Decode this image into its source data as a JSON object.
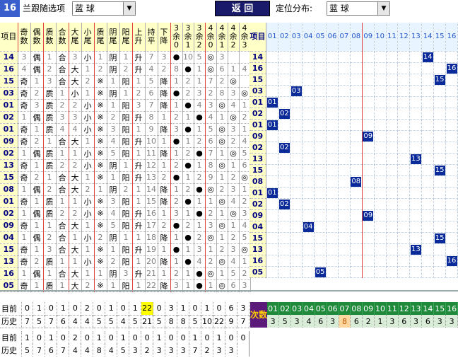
{
  "toolbar": {
    "issue_no": "16",
    "pick_label": "兰跟随选项",
    "pick_value": "蓝        球",
    "back_label": "返  回",
    "dist_label": "定位分布:",
    "dist_value": "蓝        球"
  },
  "left_headers": [
    "项目",
    "奇数",
    "偶数",
    "质数",
    "合数",
    "大尾",
    "小尾",
    "质尾",
    "阴尾",
    "阳尾",
    "上升",
    "持平",
    "下降",
    "3余0",
    "3余1",
    "3余2",
    "4余0",
    "4余1",
    "4余2",
    "4余3"
  ],
  "mid_header": "项目",
  "right_headers": [
    "01",
    "02",
    "03",
    "04",
    "05",
    "06",
    "07",
    "08",
    "09",
    "10",
    "11",
    "12",
    "13",
    "14",
    "15",
    "16"
  ],
  "rows": [
    {
      "id": "14",
      "c": [
        "3",
        "偶",
        "1",
        "合",
        "3",
        "小",
        "1",
        "阴",
        "1",
        "升",
        "7",
        "3",
        "●",
        "10",
        "5",
        "◎",
        "3"
      ],
      "ball": "14",
      "col": 13
    },
    {
      "id": "16",
      "c": [
        "4",
        "偶",
        "2",
        "合",
        "大",
        "1",
        "2",
        "阴",
        "2",
        "升",
        "4",
        "2",
        "8",
        "●",
        "1",
        "◎",
        "6",
        "1",
        "4"
      ],
      "ball": "16",
      "col": 15
    },
    {
      "id": "15",
      "c": [
        "奇",
        "1",
        "3",
        "合",
        "大",
        "2",
        "※",
        "1",
        "阳",
        "1",
        "5",
        "降",
        "1",
        "2",
        "1",
        "7",
        "2",
        "◎"
      ],
      "ball": "15",
      "col": 14
    },
    {
      "id": "03",
      "c": [
        "奇",
        "2",
        "质",
        "1",
        "小",
        "1",
        "※",
        "阴",
        "1",
        "2",
        "6",
        "降",
        "●",
        "2",
        "3",
        "2",
        "8",
        "3",
        "◎"
      ],
      "ball": "03",
      "col": 2
    },
    {
      "id": "01",
      "c": [
        "奇",
        "3",
        "质",
        "2",
        "2",
        "小",
        "※",
        "1",
        "阳",
        "3",
        "7",
        "降",
        "1",
        "●",
        "4",
        "3",
        "◎",
        "4",
        "1"
      ],
      "ball": "01",
      "col": 0
    },
    {
      "id": "02",
      "c": [
        "1",
        "偶",
        "质",
        "3",
        "3",
        "小",
        "※",
        "2",
        "阳",
        "升",
        "8",
        "1",
        "2",
        "1",
        "●",
        "4",
        "1",
        "◎",
        "2"
      ],
      "ball": "02",
      "col": 1
    },
    {
      "id": "01",
      "c": [
        "奇",
        "1",
        "质",
        "4",
        "4",
        "小",
        "※",
        "3",
        "阳",
        "1",
        "9",
        "降",
        "3",
        "●",
        "1",
        "5",
        "◎",
        "3",
        "1"
      ],
      "ball": "01",
      "col": 0
    },
    {
      "id": "09",
      "c": [
        "奇",
        "2",
        "1",
        "合",
        "大",
        "1",
        "※",
        "4",
        "阳",
        "升",
        "10",
        "1",
        "●",
        "1",
        "2",
        "6",
        "◎",
        "2",
        "4"
      ],
      "ball": "09",
      "col": 8
    },
    {
      "id": "02",
      "c": [
        "1",
        "偶",
        "质",
        "1",
        "1",
        "小",
        "※",
        "5",
        "阳",
        "1",
        "11",
        "降",
        "1",
        "2",
        "●",
        "7",
        "1",
        "◎",
        "5"
      ],
      "ball": "02",
      "col": 1
    },
    {
      "id": "13",
      "c": [
        "奇",
        "1",
        "质",
        "2",
        "2",
        "小",
        "※",
        "阴",
        "1",
        "升",
        "12",
        "1",
        "2",
        "●",
        "1",
        "8",
        "◎",
        "1",
        "6"
      ],
      "ball": "13",
      "col": 12
    },
    {
      "id": "15",
      "c": [
        "奇",
        "2",
        "1",
        "合",
        "大",
        "1",
        "※",
        "1",
        "阳",
        "升",
        "13",
        "2",
        "●",
        "1",
        "2",
        "9",
        "1",
        "2",
        "◎"
      ],
      "ball": "15",
      "col": 14
    },
    {
      "id": "08",
      "c": [
        "1",
        "偶",
        "2",
        "合",
        "大",
        "2",
        "1",
        "阴",
        "2",
        "1",
        "14",
        "降",
        "1",
        "2",
        "●",
        "◎",
        "2",
        "3",
        "1"
      ],
      "ball": "08",
      "col": 7
    },
    {
      "id": "01",
      "c": [
        "奇",
        "1",
        "质",
        "1",
        "1",
        "小",
        "※",
        "3",
        "阳",
        "1",
        "15",
        "降",
        "2",
        "●",
        "1",
        "1",
        "◎",
        "4",
        "2"
      ],
      "ball": "01",
      "col": 0
    },
    {
      "id": "02",
      "c": [
        "1",
        "偶",
        "质",
        "2",
        "2",
        "小",
        "※",
        "4",
        "阳",
        "升",
        "16",
        "1",
        "3",
        "1",
        "●",
        "2",
        "1",
        "◎",
        "3"
      ],
      "ball": "02",
      "col": 1
    },
    {
      "id": "09",
      "c": [
        "奇",
        "1",
        "1",
        "合",
        "大",
        "1",
        "※",
        "5",
        "阳",
        "升",
        "17",
        "2",
        "●",
        "2",
        "1",
        "3",
        "◎",
        "1",
        "4"
      ],
      "ball": "09",
      "col": 8
    },
    {
      "id": "04",
      "c": [
        "1",
        "偶",
        "2",
        "合",
        "1",
        "小",
        "2",
        "阴",
        "1",
        "1",
        "18",
        "降",
        "1",
        "●",
        "2",
        "◎",
        "1",
        "2",
        "5"
      ],
      "ball": "04",
      "col": 3
    },
    {
      "id": "15",
      "c": [
        "奇",
        "1",
        "3",
        "合",
        "大",
        "1",
        "※",
        "1",
        "阳",
        "升",
        "19",
        "1",
        "●",
        "1",
        "3",
        "1",
        "2",
        "3",
        "◎"
      ],
      "ball": "15",
      "col": 14
    },
    {
      "id": "13",
      "c": [
        "奇",
        "2",
        "质",
        "1",
        "1",
        "小",
        "※",
        "2",
        "阳",
        "1",
        "20",
        "降",
        "1",
        "●",
        "4",
        "2",
        "◎",
        "4",
        "1"
      ],
      "ball": "13",
      "col": 12
    },
    {
      "id": "16",
      "c": [
        "1",
        "偶",
        "1",
        "合",
        "大",
        "1",
        "1",
        "阴",
        "3",
        "升",
        "21",
        "1",
        "2",
        "1",
        "●",
        "◎",
        "1",
        "5",
        "2"
      ],
      "ball": "16",
      "col": 15
    },
    {
      "id": "05",
      "c": [
        "奇",
        "1",
        "质",
        "1",
        "大",
        "2",
        "※",
        "1",
        "阳",
        "1",
        "22",
        "降",
        "3",
        "1",
        "●",
        "1",
        "◎",
        "6",
        "3"
      ],
      "ball": "05",
      "col": 4
    }
  ],
  "summary": {
    "current_label": "目前",
    "current": [
      "0",
      "1",
      "0",
      "1",
      "0",
      "2",
      "0",
      "1",
      "0",
      "1",
      "22",
      "0",
      "3",
      "1",
      "0",
      "1",
      "0",
      "6",
      "3"
    ],
    "history_label": "历史",
    "history": [
      "7",
      "5",
      "7",
      "6",
      "4",
      "4",
      "5",
      "5",
      "4",
      "5",
      "21",
      "5",
      "8",
      "8",
      "5",
      "10",
      "22",
      "9",
      "7"
    ],
    "cishu_label": "次数",
    "cishu_nums": [
      "01",
      "02",
      "03",
      "04",
      "05",
      "06",
      "07",
      "08",
      "09",
      "10",
      "11",
      "12",
      "13",
      "14",
      "15",
      "16"
    ],
    "cishu_vals": [
      "3",
      "5",
      "3",
      "4",
      "6",
      "3",
      "8",
      "6",
      "2",
      "1",
      "3",
      "6",
      "3",
      "6",
      "3",
      "3"
    ],
    "current2_label": "目前",
    "current2": [
      "1",
      "0",
      "1",
      "0",
      "2",
      "0",
      "1",
      "0",
      "1",
      "0",
      "0",
      "1",
      "0",
      "0",
      "1",
      "0",
      "1",
      "0",
      "0"
    ],
    "history2_label": "历史",
    "history2": [
      "5",
      "7",
      "6",
      "7",
      "4",
      "4",
      "8",
      "4",
      "5",
      "3",
      "2",
      "3",
      "3",
      "3",
      "7",
      "2",
      "3",
      "3"
    ]
  },
  "colors": {
    "accent": "#0a2a9a",
    "header_bg": "#ffffc8",
    "green": "#1f8a3a",
    "purple": "#5a1a7a"
  }
}
